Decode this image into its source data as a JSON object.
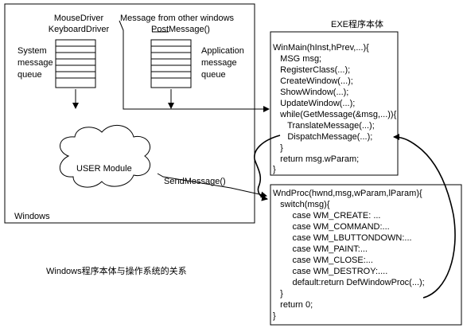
{
  "windows_box": {
    "label": "Windows",
    "mouse_driver": "MouseDriver",
    "keyboard_driver": "KeyboardDriver",
    "other_windows": "Message from other windows",
    "post_message": "PostMessage()",
    "system_queue": [
      "System",
      "message",
      "queue"
    ],
    "app_queue": [
      "Application",
      "message",
      "queue"
    ],
    "user_module": "USER Module",
    "send_message": "SendMessage()"
  },
  "exe_box": {
    "title": "EXE程序本体",
    "lines": [
      "WinMain(hInst,hPrev,...){",
      "   MSG msg;",
      "   RegisterClass(...);",
      "   CreateWindow(...);",
      "   ShowWindow(...);",
      "   UpdateWindow(...);",
      "   while(GetMessage(&msg,...)){",
      "      TranslateMessage(...);",
      "      DispatchMessage(...);",
      "   }",
      "   return msg.wParam;",
      "}"
    ]
  },
  "wndproc_box": {
    "lines": [
      "WndProc(hwnd,msg,wParam,lParam){",
      "   switch(msg){",
      "        case WM_CREATE: ...",
      "        case WM_COMMAND:...",
      "        case WM_LBUTTONDOWN:...",
      "        case WM_PAINT:...",
      "        case WM_CLOSE:...",
      "        case WM_DESTROY:....",
      "        default:return DefWindowProc(...);",
      "   }",
      "   return 0;",
      "}"
    ]
  },
  "caption": "Windows程序本体与操作系统的关系",
  "colors": {
    "line": "#000000",
    "background": "#ffffff"
  }
}
